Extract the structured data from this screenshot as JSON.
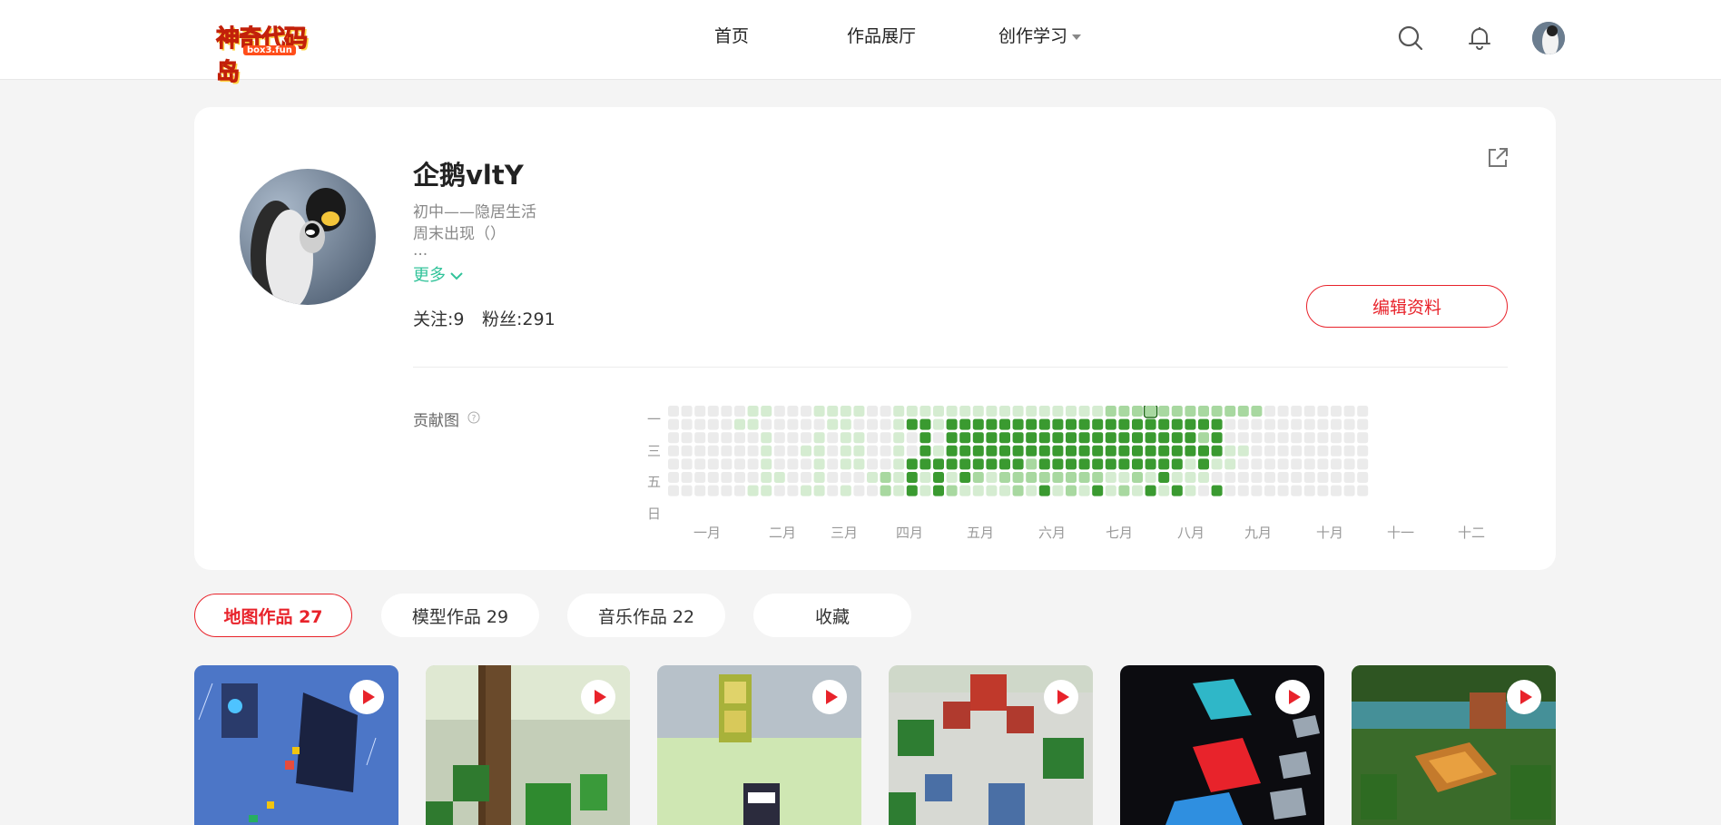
{
  "nav": {
    "logo_text": "神奇代码岛",
    "logo_sub": "box3.fun",
    "items": [
      {
        "label": "首页"
      },
      {
        "label": "作品展厅"
      },
      {
        "label": "创作学习"
      }
    ]
  },
  "profile": {
    "username": "企鹅vltY",
    "bio_lines": [
      "初中——隐居生活",
      "周末出现（）",
      "..."
    ],
    "more_label": "更多",
    "follow_text": "关注:9",
    "fans_text": "粉丝:291",
    "edit_label": "编辑资料",
    "contrib_label": "贡献图"
  },
  "heatmap": {
    "day_labels": [
      "一",
      "三",
      "五",
      "日"
    ],
    "month_labels": [
      "一月",
      "二月",
      "三月",
      "四月",
      "五月",
      "六月",
      "七月",
      "八月",
      "九月",
      "十月",
      "十一",
      "十二"
    ],
    "weeks": 53,
    "levels": [
      "#ebebeb",
      "#d5ecd1",
      "#a8d8a0",
      "#3a9a30"
    ],
    "rows": [
      "00000011000111100111111111111111122222222222200000000000000000000",
      "00000110000011000133133333333333333333333300000000000000000000000",
      "00000001000101100103033333333333333333332300000000000000000000000",
      "00000001001101100103133333333333333333333311000000000000000000000",
      "00000001000101100133333333323333333333313110000000000000000000000",
      "00000001100100012131313212222222211213111000000000000000000000000",
      "00000011001101002131321111213121312131310300000000000000000000000"
    ]
  },
  "tabs": [
    {
      "label": "地图作品 27"
    },
    {
      "label": "模型作品 29"
    },
    {
      "label": "音乐作品 22"
    },
    {
      "label": "收藏"
    }
  ],
  "colors": {
    "accent": "#e8232b",
    "more": "#32c39a",
    "contrib": "#3a9a30"
  }
}
